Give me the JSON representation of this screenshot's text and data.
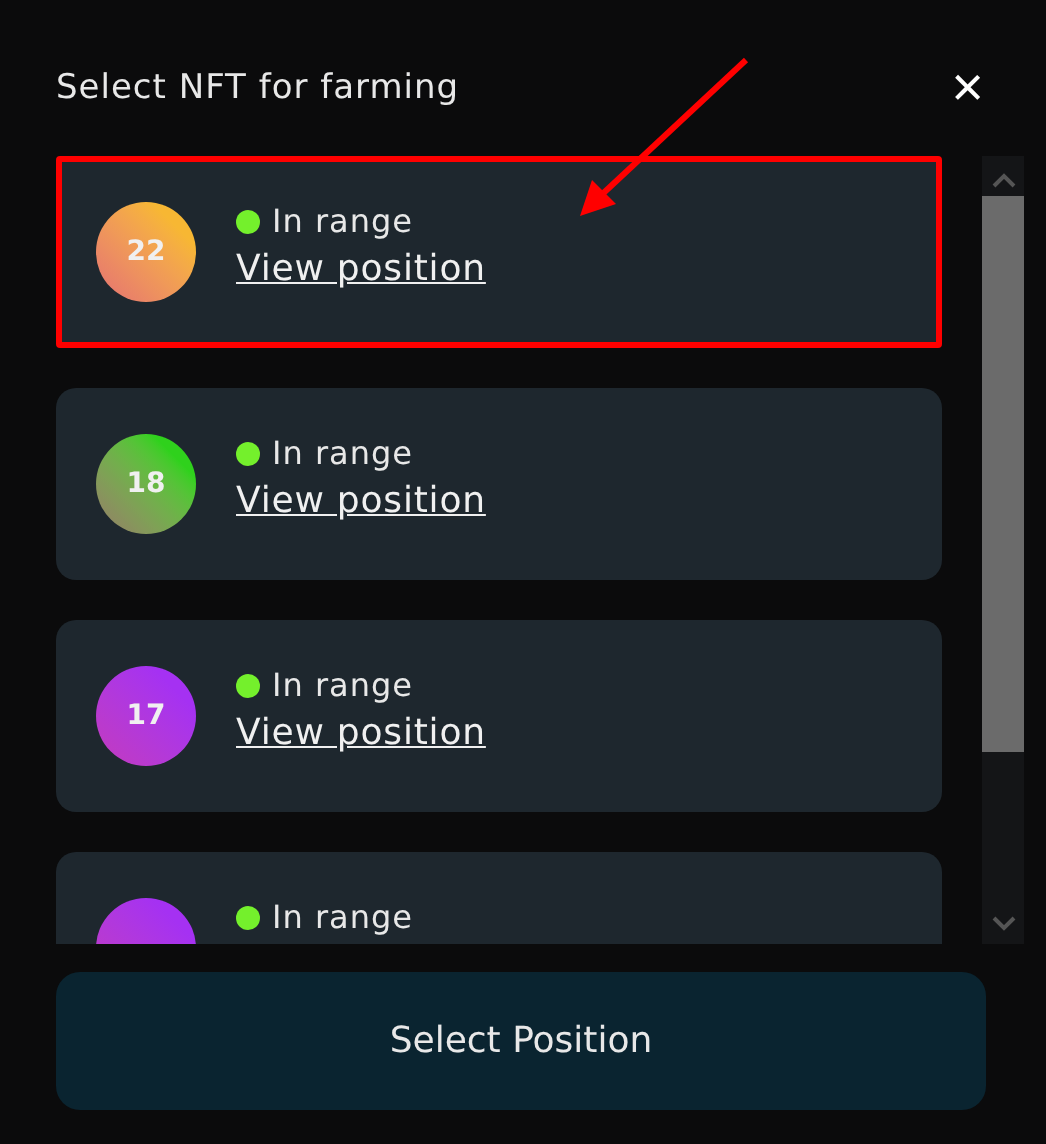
{
  "dialog": {
    "title": "Select NFT for farming",
    "close_icon": "×"
  },
  "positions": [
    {
      "number": "22",
      "color": "#f7b733",
      "status": "In range",
      "in_range": true,
      "link": "View position",
      "highlighted": true
    },
    {
      "number": "18",
      "color": "#2fd11c",
      "status": "In range",
      "in_range": true,
      "link": "View position",
      "highlighted": false
    },
    {
      "number": "17",
      "color": "#a531f2",
      "status": "In range",
      "in_range": true,
      "link": "View position",
      "highlighted": false
    },
    {
      "color": "#a531f2",
      "status": "In range",
      "in_range": true,
      "highlighted": false
    }
  ],
  "annotation": {
    "kind": "arrow"
  },
  "button": "Select Position"
}
